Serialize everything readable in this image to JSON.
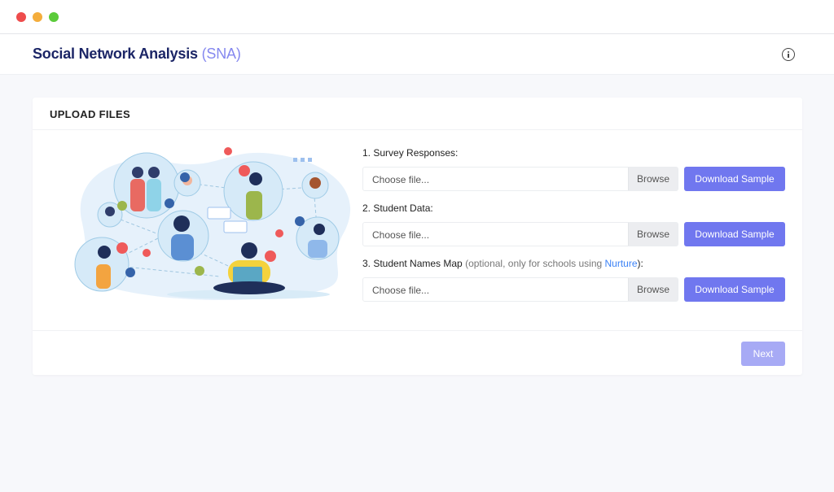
{
  "window": {
    "controls": [
      "close",
      "minimize",
      "maximize"
    ],
    "colors": {
      "close": "#ee4c4c",
      "minimize": "#f4ad3c",
      "maximize": "#5bcb3a"
    }
  },
  "header": {
    "title": "Social Network Analysis",
    "abbreviation": "(SNA)",
    "info_icon": "info-circle-icon"
  },
  "card": {
    "title": "UPLOAD FILES",
    "illustration": "social-network-people-illustration",
    "fields": [
      {
        "label": "1. Survey Responses:",
        "placeholder": "Choose file...",
        "browse_label": "Browse",
        "download_label": "Download Sample"
      },
      {
        "label": "2. Student Data:",
        "placeholder": "Choose file...",
        "browse_label": "Browse",
        "download_label": "Download Sample"
      },
      {
        "label": "3. Student Names Map",
        "label_optional": " (optional, only for schools using ",
        "label_link": "Nurture",
        "label_end": "):",
        "placeholder": "Choose file...",
        "browse_label": "Browse",
        "download_label": "Download Sample"
      }
    ],
    "next_label": "Next"
  },
  "colors": {
    "brand": "#1b2566",
    "accent": "#7077ef",
    "accent_disabled": "#a7aaf5",
    "link": "#3b82f6"
  }
}
